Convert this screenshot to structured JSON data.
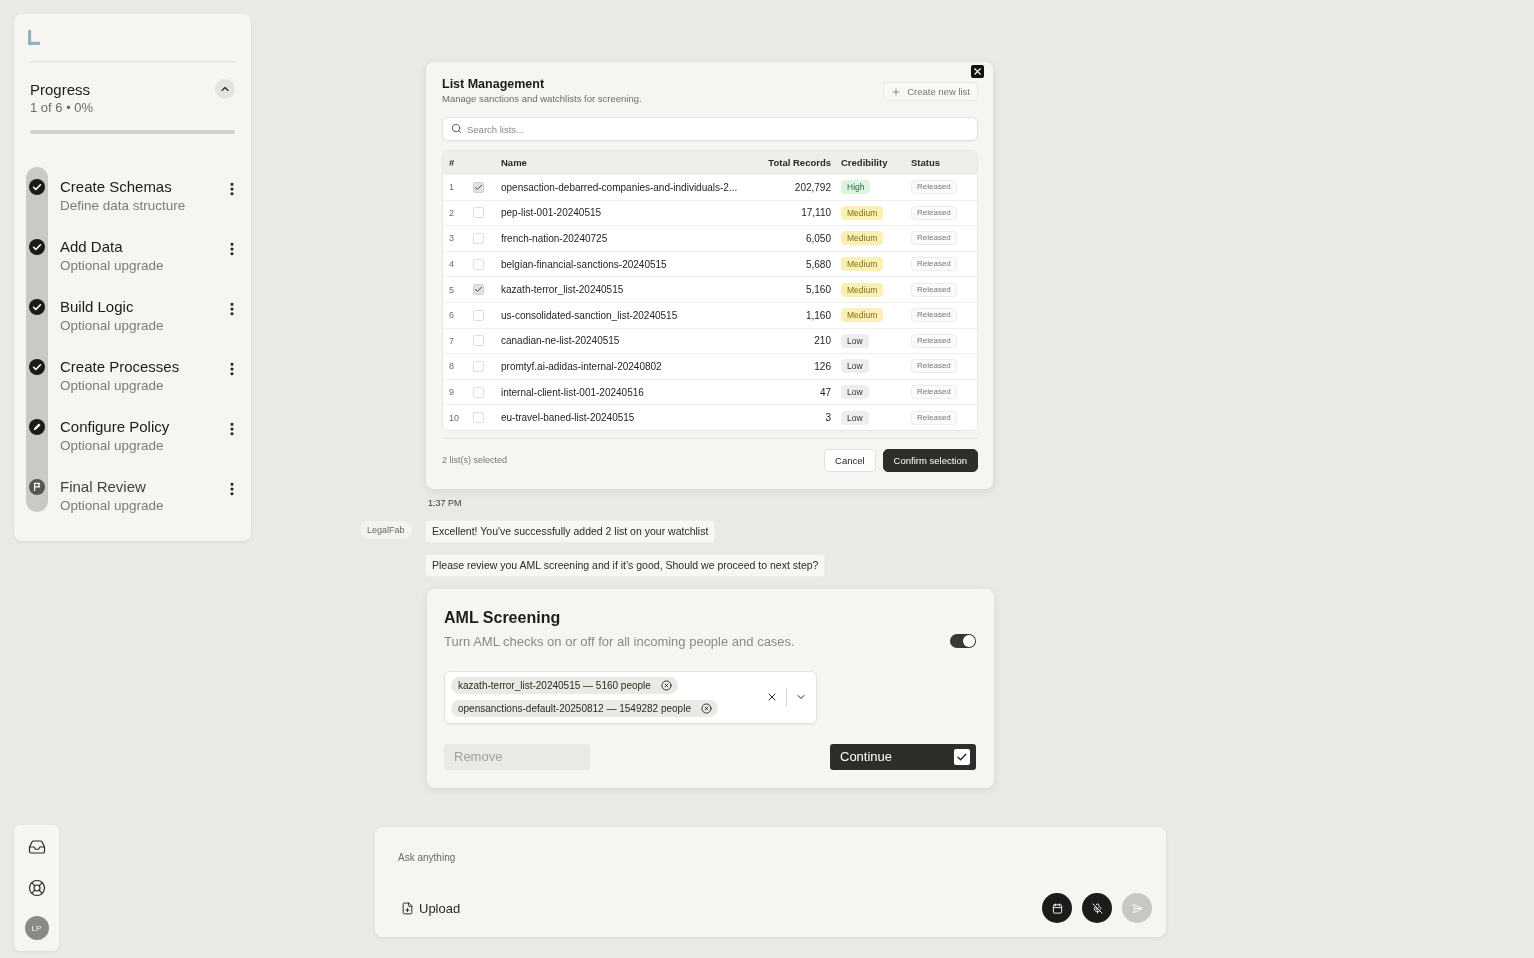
{
  "sidebar": {
    "progress": {
      "title": "Progress",
      "summary": "1 of 6 • 0%",
      "level": 0,
      "expanded": true
    },
    "steps": [
      {
        "title": "Create Schemas",
        "subtitle": "Define data structure",
        "kind": "done"
      },
      {
        "title": "Add Data",
        "subtitle": "Optional upgrade",
        "kind": "done"
      },
      {
        "title": "Build Logic",
        "subtitle": "Optional upgrade",
        "kind": "done"
      },
      {
        "title": "Create Processes",
        "subtitle": "Optional upgrade",
        "kind": "done"
      },
      {
        "title": "Configure Policy",
        "subtitle": "Optional upgrade",
        "kind": "current"
      },
      {
        "title": "Final Review",
        "subtitle": "Optional upgrade",
        "kind": "pending"
      }
    ]
  },
  "nav": {
    "avatar": "LP"
  },
  "list_management": {
    "title": "List Management",
    "subtitle": "Manage sanctions and watchlists for screening.",
    "create_button": "Create new list",
    "search": {
      "placeholder": "Search lists..."
    },
    "columns": [
      "#",
      "Name",
      "Total Records",
      "Credibility",
      "Status"
    ],
    "rows": [
      {
        "number": "1",
        "checked": true,
        "name": "opensaction-debarred-companies-and-individuals-2...",
        "records": "202,792",
        "credibility": {
          "label": "High",
          "color": "#dcf4e2"
        },
        "status": "Released"
      },
      {
        "number": "2",
        "checked": false,
        "name": "pep-list-001-20240515",
        "records": "17,110",
        "credibility": {
          "label": "Medium",
          "color": "#fbf0b3"
        },
        "status": "Released"
      },
      {
        "number": "3",
        "checked": false,
        "name": "french-nation-20240725",
        "records": "6,050",
        "credibility": {
          "label": "Medium",
          "color": "#fbf0b3"
        },
        "status": "Released"
      },
      {
        "number": "4",
        "checked": false,
        "name": "belgian-financial-sanctions-20240515",
        "records": "5,680",
        "credibility": {
          "label": "Medium",
          "color": "#fbf0b3"
        },
        "status": "Released"
      },
      {
        "number": "5",
        "checked": true,
        "name": "kazath-terror_list-20240515",
        "records": "5,160",
        "credibility": {
          "label": "Medium",
          "color": "#fbf0b3"
        },
        "status": "Released"
      },
      {
        "number": "6",
        "checked": false,
        "name": "us-consolidated-sanction_list-20240515",
        "records": "1,160",
        "credibility": {
          "label": "Medium",
          "color": "#fbf0b3"
        },
        "status": "Released"
      },
      {
        "number": "7",
        "checked": false,
        "name": "canadian-ne-list-20240515",
        "records": "210",
        "credibility": {
          "label": "Low",
          "color": "#eeeeef"
        },
        "status": "Released"
      },
      {
        "number": "8",
        "checked": false,
        "name": "promtyf.ai-adidas-internal-20240802",
        "records": "126",
        "credibility": {
          "label": "Low",
          "color": "#eeeeef"
        },
        "status": "Released"
      },
      {
        "number": "9",
        "checked": false,
        "name": "internal-client-list-001-20240516",
        "records": "47",
        "credibility": {
          "label": "Low",
          "color": "#eeeeef"
        },
        "status": "Released"
      },
      {
        "number": "10",
        "checked": false,
        "name": "eu-travel-baned-list-20240515",
        "records": "3",
        "credibility": {
          "label": "Low",
          "color": "#eeeeef"
        },
        "status": "Released"
      }
    ],
    "selection_summary": "2 list(s) selected",
    "cancel_button": "Cancel",
    "confirm_button": "Confirm selection"
  },
  "chat": {
    "timestamp": "1:37 PM",
    "sender": "LegalFab",
    "messages": [
      "Excellent! You've successfully added 2 list on your watchlist",
      "Please review you AML screening and if it’s good, Should we proceed to next step?"
    ]
  },
  "aml_screening": {
    "title": "AML Screening",
    "description": "Turn AML checks on or off for all incoming people and cases.",
    "enabled": true,
    "selected_lists": [
      "kazath-terror_list-20240515 — 5160 people",
      "opensanctions-default-20250812 — 1549282 people"
    ],
    "remove_button": {
      "label": "Remove",
      "disabled": true
    },
    "continue_button": "Continue"
  },
  "composer": {
    "placeholder": "Ask anything",
    "upload_button": "Upload",
    "send_disabled": true
  }
}
